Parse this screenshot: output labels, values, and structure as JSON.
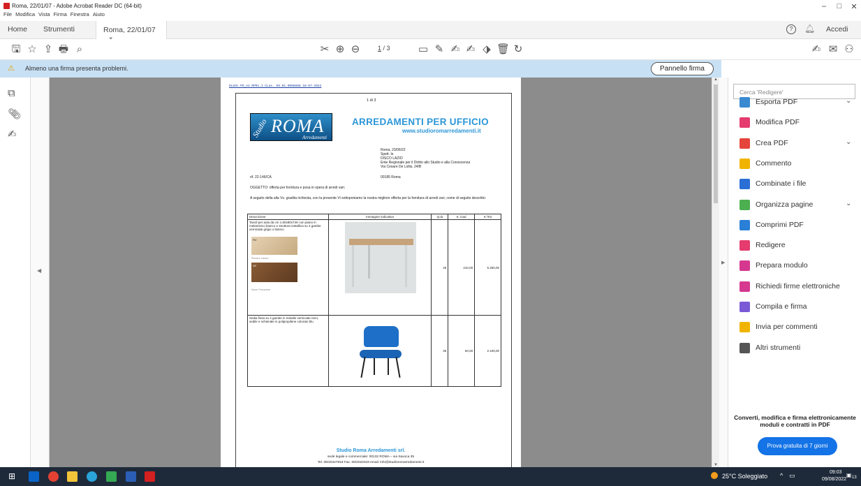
{
  "window": {
    "title": "Roma, 22/01/07 - Adobe Acrobat Reader DC (64-bit)",
    "minimize": "–",
    "maximize": "□",
    "close": "✕"
  },
  "menu": [
    "File",
    "Modifica",
    "Vista",
    "Firma",
    "Finestra",
    "Aiuto"
  ],
  "tabs": {
    "home": "Home",
    "tools": "Strumenti",
    "doc": "Roma, 22/01/07",
    "doc_close": "×",
    "help": "?",
    "signin": "Accedi"
  },
  "toolbar": {
    "page_current": "1",
    "page_total": "/ 3"
  },
  "notice": {
    "message": "Almeno una firma presenta problemi.",
    "button": "Pannello firma"
  },
  "right_panel": {
    "search_placeholder": "Cerca 'Redigere'",
    "tools": [
      {
        "label": "Esporta PDF",
        "icon": "export-pdf-icon",
        "color": "#3a8ad1",
        "chevron": true
      },
      {
        "label": "Modifica PDF",
        "icon": "edit-pdf-icon",
        "color": "#e53b6e",
        "chevron": false
      },
      {
        "label": "Crea PDF",
        "icon": "create-pdf-icon",
        "color": "#e5453b",
        "chevron": true
      },
      {
        "label": "Commento",
        "icon": "comment-icon",
        "color": "#f0b400",
        "chevron": false
      },
      {
        "label": "Combinate i file",
        "icon": "combine-files-icon",
        "color": "#2a6fd6",
        "chevron": false
      },
      {
        "label": "Organizza pagine",
        "icon": "organize-pages-icon",
        "color": "#4caf50",
        "chevron": true
      },
      {
        "label": "Comprimi PDF",
        "icon": "compress-pdf-icon",
        "color": "#2a7fd6",
        "chevron": false
      },
      {
        "label": "Redigere",
        "icon": "redact-icon",
        "color": "#e53b6e",
        "chevron": false
      },
      {
        "label": "Prepara modulo",
        "icon": "prepare-form-icon",
        "color": "#d6388f",
        "chevron": false
      },
      {
        "label": "Richiedi firme elettroniche",
        "icon": "request-signatures-icon",
        "color": "#d6388f",
        "chevron": false
      },
      {
        "label": "Compila e firma",
        "icon": "fill-sign-icon",
        "color": "#7a5ad6",
        "chevron": false
      },
      {
        "label": "Invia per commenti",
        "icon": "send-comments-icon",
        "color": "#f0b400",
        "chevron": false
      },
      {
        "label": "Altri strumenti",
        "icon": "more-tools-icon",
        "color": "#555555",
        "chevron": false
      }
    ],
    "promo_line1": "Converti, modifica e firma elettronicamente",
    "promo_line2": "moduli e contratti in PDF",
    "trial_button": "Prova gratuita di 7 giorni"
  },
  "document": {
    "header_code": "DLGOc.PO_A4.RP01.I.CLas. 09.01.0008888.18-07-2022",
    "page_label": "1 di 3",
    "logo_main": "ROMA",
    "logo_studio": "Studio",
    "logo_sub": "Arredamenti",
    "title": "ARREDAMENTI PER UFFICIO",
    "website": "www.studioromarredamenti.it",
    "address": [
      "Roma, 23/06/22",
      "Spett. le",
      "DISCO LAZIO",
      "Ente Regionale per il Diritto allo Studio e alla Conoscenza",
      "Via Cesare De Lollis, 24/B",
      "00185 Roma"
    ],
    "ref": "rif. 22-146/CA",
    "subject": "OGGETTO: offerta per fornitura e posa in opera di arredi vari.",
    "intro": "A seguito della alla Vs. gradita richiesta, con la presente Vi sottoponiamo la nostra migliore offerta per la fornitura di arredi vari, come di seguito descritto:",
    "table_headers": [
      "Descrizione",
      "Immagine indicativa",
      "Q.tà",
      "€. /cad",
      "€ /Tot"
    ],
    "rows": [
      {
        "desc": "Tavoli per aula da cm 1.60x80x74H con piano in melaminico bianco e struttura metallica su 4 gambe verniciate grigio o bianco",
        "swatch1": "Rovere chiaro",
        "swatch2": "Noce Francese",
        "sw1code": "RV",
        "sw2code": "NF",
        "qty": "25",
        "unit": "210,00",
        "total": "5.250,00"
      },
      {
        "desc": "Sedia fissa su 4 gambe in metallo verniciate nero, sedile e schienale in polipropilene colorato blu",
        "qty": "35",
        "unit": "60,00",
        "total": "2.100,00"
      }
    ],
    "footer_company": "Studio Roma Arredamenti srl.",
    "footer_line1": "sede legale e commerciale: 00132 ROMA – via Savoca 35",
    "footer_line2": "Tel. 06/20427818 Fax. 06/2022019 email: info@studioromarredamenti.it"
  },
  "taskbar": {
    "weather": "25°C Soleggiato",
    "time": "09:03",
    "date": "09/08/2022",
    "notif": "13"
  }
}
